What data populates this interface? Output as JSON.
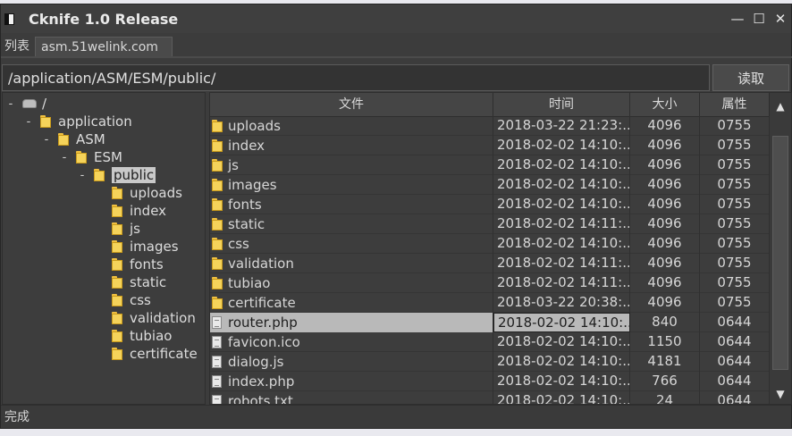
{
  "window": {
    "title": "Cknife 1.0 Release",
    "minimize_glyph": "—",
    "maximize_glyph": "☐",
    "close_glyph": "✕"
  },
  "tabs": [
    {
      "label": "列表"
    },
    {
      "label": "asm.51welink.com"
    }
  ],
  "address": {
    "path": "/application/ASM/ESM/public/",
    "read_label": "读取"
  },
  "tree": {
    "nodes": [
      {
        "label": "/",
        "toggle": "-",
        "icon": "drive-icon"
      },
      {
        "label": "application",
        "toggle": "-",
        "icon": "folder-icon"
      },
      {
        "label": "ASM",
        "toggle": "-",
        "icon": "folder-icon"
      },
      {
        "label": "ESM",
        "toggle": "-",
        "icon": "folder-icon"
      },
      {
        "label": "public",
        "toggle": "-",
        "icon": "folder-icon",
        "selected": true
      },
      {
        "label": "uploads",
        "icon": "folder-icon"
      },
      {
        "label": "index",
        "icon": "folder-icon"
      },
      {
        "label": "js",
        "icon": "folder-icon"
      },
      {
        "label": "images",
        "icon": "folder-icon"
      },
      {
        "label": "fonts",
        "icon": "folder-icon"
      },
      {
        "label": "static",
        "icon": "folder-icon"
      },
      {
        "label": "css",
        "icon": "folder-icon"
      },
      {
        "label": "validation",
        "icon": "folder-icon"
      },
      {
        "label": "tubiao",
        "icon": "folder-icon"
      },
      {
        "label": "certificate",
        "icon": "folder-icon"
      }
    ]
  },
  "files": {
    "columns": [
      "文件",
      "时间",
      "大小",
      "属性"
    ],
    "rows": [
      {
        "name": "uploads",
        "time": "2018-03-22 21:23:...",
        "size": "4096",
        "attr": "0755",
        "icon": "folder-icon"
      },
      {
        "name": "index",
        "time": "2018-02-02 14:10:...",
        "size": "4096",
        "attr": "0755",
        "icon": "folder-icon"
      },
      {
        "name": "js",
        "time": "2018-02-02 14:10:...",
        "size": "4096",
        "attr": "0755",
        "icon": "folder-icon"
      },
      {
        "name": "images",
        "time": "2018-02-02 14:10:...",
        "size": "4096",
        "attr": "0755",
        "icon": "folder-icon"
      },
      {
        "name": "fonts",
        "time": "2018-02-02 14:10:...",
        "size": "4096",
        "attr": "0755",
        "icon": "folder-icon"
      },
      {
        "name": "static",
        "time": "2018-02-02 14:11:...",
        "size": "4096",
        "attr": "0755",
        "icon": "folder-icon"
      },
      {
        "name": "css",
        "time": "2018-02-02 14:10:...",
        "size": "4096",
        "attr": "0755",
        "icon": "folder-icon"
      },
      {
        "name": "validation",
        "time": "2018-02-02 14:11:...",
        "size": "4096",
        "attr": "0755",
        "icon": "folder-icon"
      },
      {
        "name": "tubiao",
        "time": "2018-02-02 14:11:...",
        "size": "4096",
        "attr": "0755",
        "icon": "folder-icon"
      },
      {
        "name": "certificate",
        "time": "2018-03-22 20:38:...",
        "size": "4096",
        "attr": "0755",
        "icon": "folder-icon"
      },
      {
        "name": "router.php",
        "time": "2018-02-02 14:10:...",
        "size": "840",
        "attr": "0644",
        "icon": "file-icon",
        "selected": true
      },
      {
        "name": "favicon.ico",
        "time": "2018-02-02 14:10:...",
        "size": "1150",
        "attr": "0644",
        "icon": "file-icon"
      },
      {
        "name": "dialog.js",
        "time": "2018-02-02 14:10:...",
        "size": "4181",
        "attr": "0644",
        "icon": "file-icon"
      },
      {
        "name": "index.php",
        "time": "2018-02-02 14:10:...",
        "size": "766",
        "attr": "0644",
        "icon": "file-icon"
      },
      {
        "name": "robots.txt",
        "time": "2018-02-02 14:10:...",
        "size": "24",
        "attr": "0644",
        "icon": "file-icon"
      }
    ]
  },
  "scroll": {
    "up_glyph": "▲",
    "down_glyph": "▼"
  },
  "status": {
    "text": "完成"
  }
}
